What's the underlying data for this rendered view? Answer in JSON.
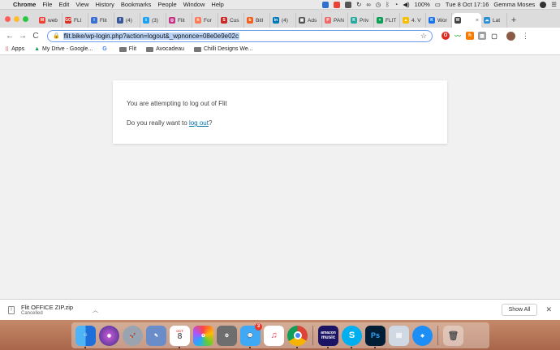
{
  "menubar": {
    "app_name": "Chrome",
    "items": [
      "File",
      "Edit",
      "View",
      "History",
      "Bookmarks",
      "People",
      "Window",
      "Help"
    ],
    "battery": "100%",
    "clock": "Tue 8 Oct  17:16",
    "user": "Gemma Moses"
  },
  "tabs": [
    {
      "label": "web",
      "icon": "gmail-icon",
      "color": "#ea4335",
      "glyph": "M"
    },
    {
      "label": "FLI",
      "icon": "go-icon",
      "color": "#d93025",
      "glyph": "GO"
    },
    {
      "label": "Flit",
      "icon": "flit-icon",
      "color": "#3b6fd1",
      "glyph": "i"
    },
    {
      "label": "(4)",
      "icon": "facebook-icon",
      "color": "#3b5998",
      "glyph": "f"
    },
    {
      "label": "(3)",
      "icon": "twitter-icon",
      "color": "#1da1f2",
      "glyph": "t"
    },
    {
      "label": "Flit",
      "icon": "instagram-icon",
      "color": "#c13584",
      "glyph": "◎"
    },
    {
      "label": "For",
      "icon": "hubspot-icon",
      "color": "#ff7a59",
      "glyph": "h"
    },
    {
      "label": "Cus",
      "icon": "shopify-icon",
      "color": "#c62828",
      "glyph": "S"
    },
    {
      "label": "Bitl",
      "icon": "bitly-icon",
      "color": "#ee6123",
      "glyph": "b"
    },
    {
      "label": "(4)",
      "icon": "linkedin-icon",
      "color": "#0077b5",
      "glyph": "in"
    },
    {
      "label": "Ads",
      "icon": "ads-icon",
      "color": "#555555",
      "glyph": "▣"
    },
    {
      "label": "PAN",
      "icon": "pan-icon",
      "color": "#f06a6a",
      "glyph": "P"
    },
    {
      "label": "Priv",
      "icon": "privacy-icon",
      "color": "#2aa8a0",
      "glyph": "K"
    },
    {
      "label": "FLIT",
      "icon": "sheets-icon",
      "color": "#0f9d58",
      "glyph": "+"
    },
    {
      "label": "4. V",
      "icon": "drive-icon",
      "color": "#fbbc04",
      "glyph": "▲"
    },
    {
      "label": "Wor",
      "icon": "k-icon",
      "color": "#1a73e8",
      "glyph": "K"
    },
    {
      "label": "",
      "icon": "wordpress-icon",
      "color": "#444444",
      "glyph": "W",
      "active": true
    },
    {
      "label": "Lat",
      "icon": "cloud-icon",
      "color": "#2b8fd6",
      "glyph": "☁"
    }
  ],
  "address": {
    "url": "flit.bike/wp-login.php?action=logout&_wpnonce=08e0e9e02c"
  },
  "bookmarks": [
    {
      "label": "Apps",
      "icon": "apps-grid-icon"
    },
    {
      "label": "My Drive - Google...",
      "icon": "drive-icon"
    },
    {
      "label": "",
      "icon": "google-icon"
    },
    {
      "label": "Flit",
      "icon": "folder-icon"
    },
    {
      "label": "Avocadeau",
      "icon": "folder-icon"
    },
    {
      "label": "Chilli Designs We...",
      "icon": "folder-icon"
    }
  ],
  "page": {
    "line1": "You are attempting to log out of Flit",
    "line2_prefix": "Do you really want to ",
    "line2_link": "log out",
    "line2_suffix": "?"
  },
  "download": {
    "filename": "Flit OFFICE ZIP.zip",
    "status": "Cancelled",
    "show_all": "Show All"
  },
  "dock": {
    "messages_badge": "3",
    "calendar_month": "OCT",
    "calendar_day": "8",
    "amazon_line1": "amazon",
    "amazon_line2": "music",
    "photoshop_label": "Ps"
  },
  "colors": {
    "link": "#0073aa",
    "url_highlight": "#b8d2f6",
    "omnibox_border": "#6b9cf0"
  }
}
